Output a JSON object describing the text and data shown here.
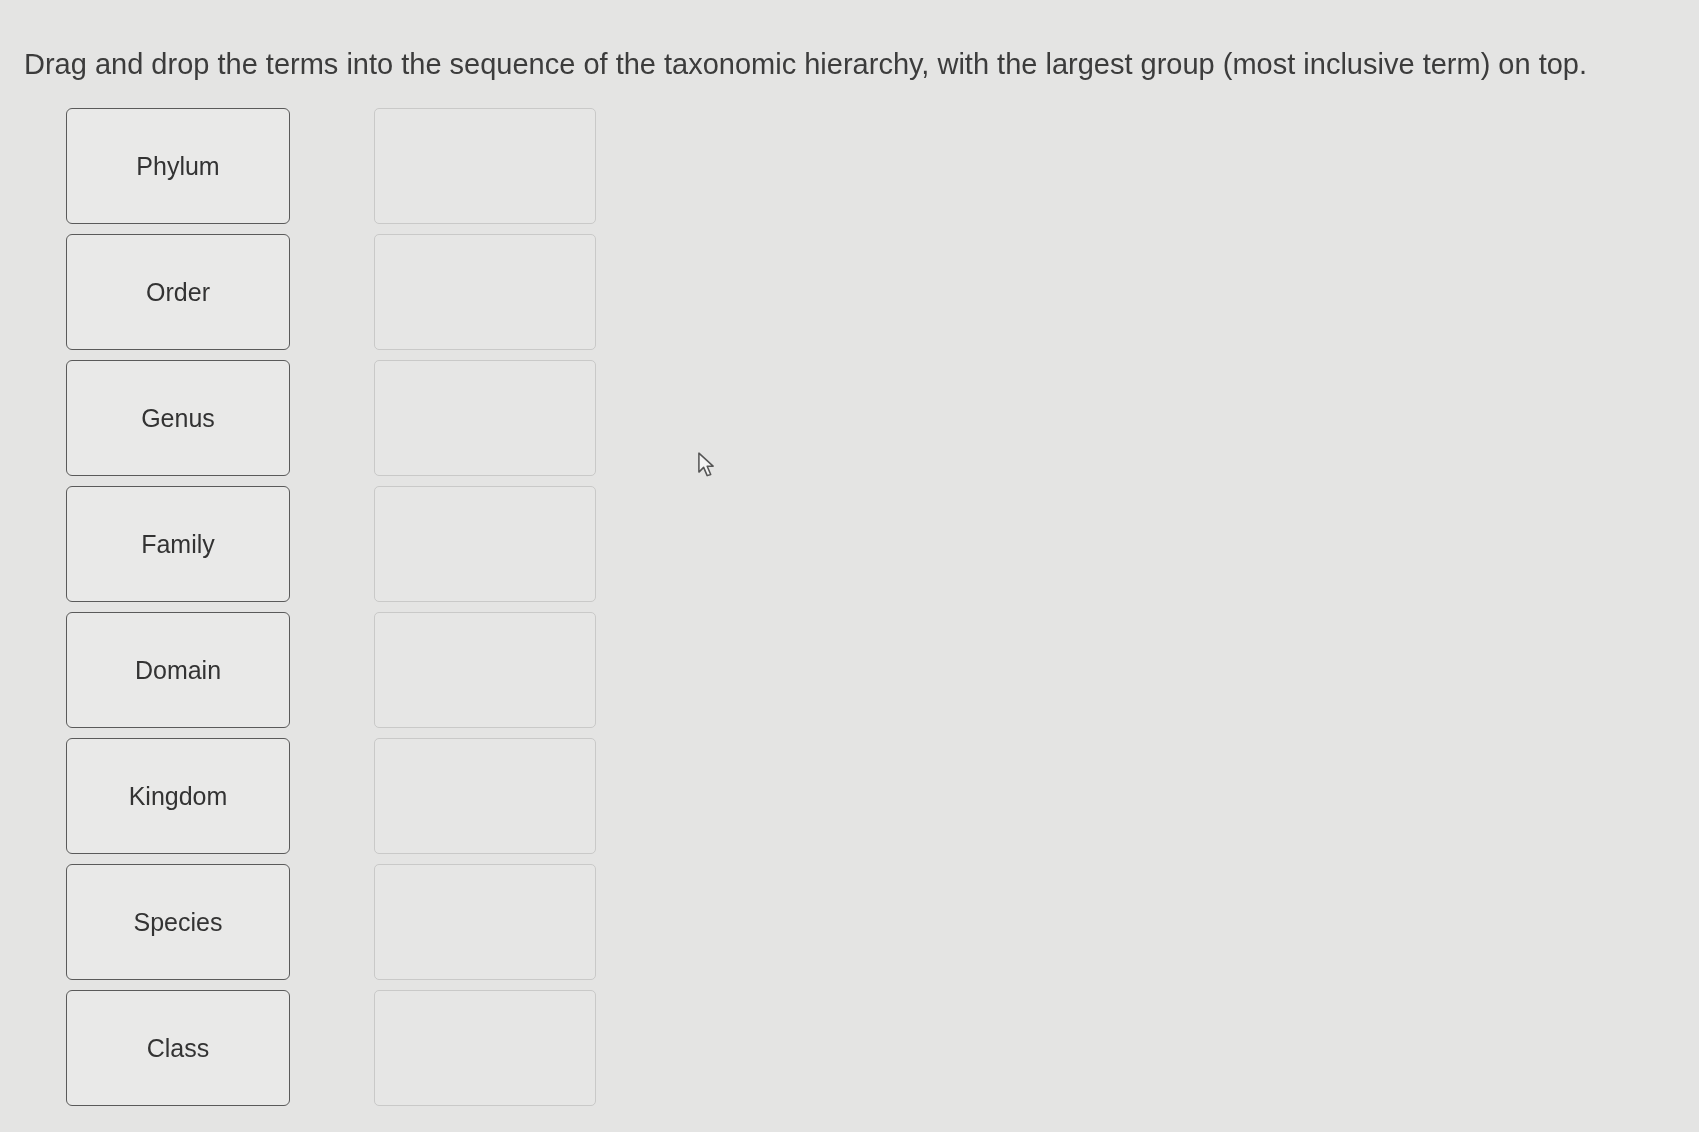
{
  "instruction": "Drag and drop the terms into the sequence of the taxonomic hierarchy, with the largest group (most inclusive term) on top.",
  "terms": [
    "Phylum",
    "Order",
    "Genus",
    "Family",
    "Domain",
    "Kingdom",
    "Species",
    "Class"
  ]
}
